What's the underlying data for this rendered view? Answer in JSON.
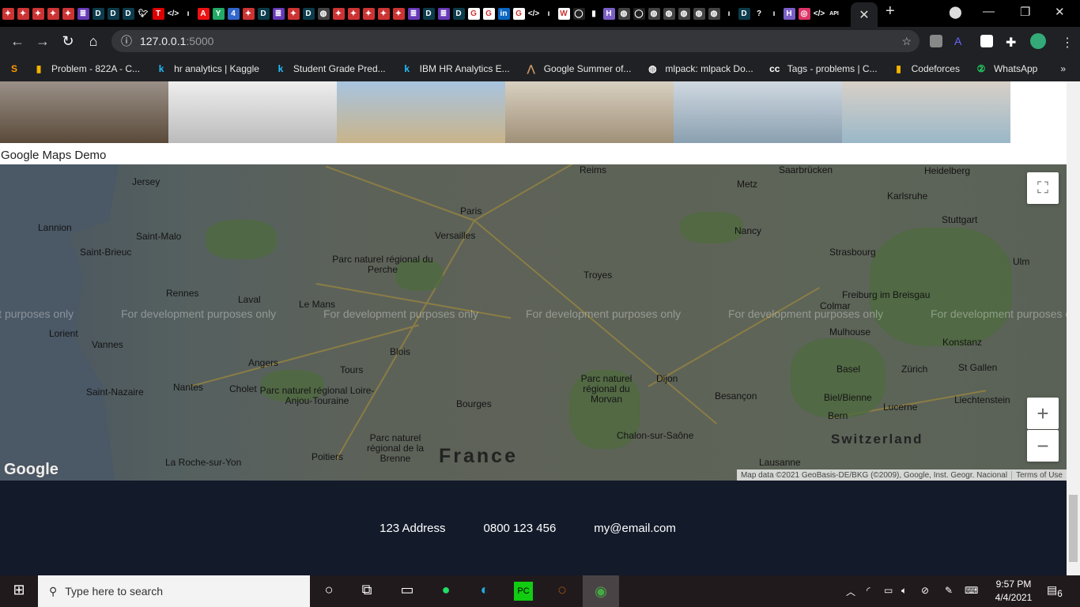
{
  "browser": {
    "tab_favicons": [
      "mlh",
      "mlh",
      "mlh",
      "mlh",
      "mlh",
      "forms",
      "D",
      "D",
      "D",
      "twitter",
      "T",
      "code",
      "n",
      "A",
      "Y",
      "454",
      "mlh",
      "D",
      "forms",
      "mlh",
      "D",
      "globe",
      "mlh",
      "mlh",
      "mlh",
      "mlh",
      "mlh",
      "forms",
      "D",
      "forms",
      "D",
      "G",
      "G",
      "in",
      "G",
      "code",
      "n",
      "W",
      "github",
      "chart",
      "H",
      "globe",
      "github",
      "globe",
      "globe",
      "globe",
      "globe",
      "globe",
      "n",
      "D",
      "?",
      "n",
      "H",
      "instagram",
      "code",
      "API"
    ],
    "active_tab_close": "✕",
    "new_tab": "+",
    "url_host": "127.0.0.1",
    "url_port": ":5000",
    "bookmarks": [
      {
        "label": "Problem - 822A - C...",
        "icon": "chart-icon"
      },
      {
        "label": "hr analytics | Kaggle",
        "icon": "kaggle-icon"
      },
      {
        "label": "Student Grade Pred...",
        "icon": "kaggle-icon"
      },
      {
        "label": "IBM HR Analytics E...",
        "icon": "kaggle-icon"
      },
      {
        "label": "Google Summer of...",
        "icon": "gsoc-icon"
      },
      {
        "label": "mlpack: mlpack Do...",
        "icon": "globe-icon"
      },
      {
        "label": "Tags - problems | C...",
        "icon": "cc-icon"
      },
      {
        "label": "Codeforces",
        "icon": "chart-icon"
      },
      {
        "label": "WhatsApp",
        "icon": "whatsapp-icon"
      }
    ],
    "bookmarks_overflow": "»"
  },
  "page": {
    "photos": [
      "opera",
      "statue",
      "sacre-coeur",
      "pantheon",
      "louvre-pyramid",
      "louvre"
    ],
    "demo_title": "Google Maps Demo",
    "map": {
      "watermark": "For development purposes only",
      "labels": [
        "Jersey",
        "Lannion",
        "Saint-Malo",
        "Saint-Brieuc",
        "Rennes",
        "Laval",
        "Le Mans",
        "Lorient",
        "Vannes",
        "Angers",
        "Tours",
        "Blois",
        "Nantes",
        "Cholet",
        "Saint-Nazaire",
        "La Roche-sur-Yon",
        "Poitiers",
        "Bourges",
        "Paris",
        "Versailles",
        "Reims",
        "Troyes",
        "Metz",
        "Nancy",
        "Strasbourg",
        "Saarbrücken",
        "Heidelberg",
        "Karlsruhe",
        "Stuttgart",
        "Ulm",
        "Colmar",
        "Freiburg im Breisgau",
        "Mulhouse",
        "Basel",
        "Zürich",
        "Konstanz",
        "St Gallen",
        "Liechtenstein",
        "Bern",
        "Lucerne",
        "Biel/Bienne",
        "Lausanne",
        "Besançon",
        "Dijon",
        "Chalon-sur-Saône",
        "Parc naturel régional du Perche",
        "Parc naturel régional Loire-Anjou-Touraine",
        "Parc naturel régional de la Brenne",
        "Parc naturel régional du Morvan"
      ],
      "country_labels": [
        "France",
        "Switzerland"
      ],
      "attribution": "Map data ©2021 GeoBasis-DE/BKG (©2009), Google, Inst. Geogr. Nacional",
      "terms": "Terms of Use",
      "logo": "Google",
      "zoom_in": "+",
      "zoom_out": "−"
    },
    "footer": {
      "address": "123 Address",
      "phone": "0800 123 456",
      "email": "my@email.com"
    }
  },
  "taskbar": {
    "search_placeholder": "Type here to search",
    "time": "9:57 PM",
    "date": "4/4/2021",
    "notifications": "6"
  }
}
